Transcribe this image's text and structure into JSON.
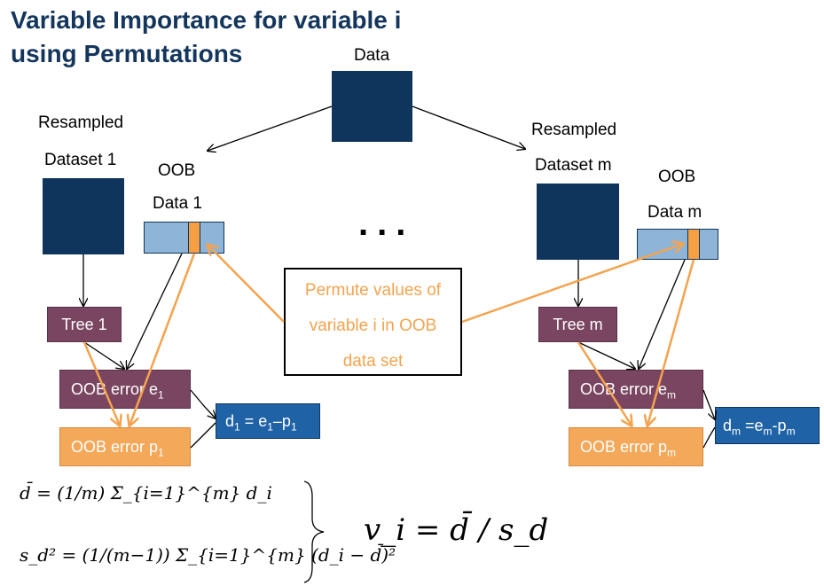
{
  "title": {
    "line1": "Variable Importance for variable i",
    "line2": "using Permutations"
  },
  "data_label": "Data",
  "left": {
    "resampled": "Resampled",
    "dataset": "Dataset 1",
    "oob": "OOB",
    "oob_data": "Data 1",
    "tree": "Tree 1",
    "err_e": "OOB error e",
    "err_e_sub": "1",
    "err_p": "OOB error p",
    "err_p_sub": "1",
    "d_main": "d",
    "d_sub": "1",
    "d_eq": " = e",
    "d_eq_sub": "1",
    "d_minus": "–p",
    "d_minus_sub": "1"
  },
  "right": {
    "resampled": "Resampled",
    "dataset": "Dataset m",
    "oob": "OOB",
    "oob_data": "Data m",
    "tree": "Tree m",
    "err_e": "OOB error e",
    "err_e_sub": "m",
    "err_p": "OOB error p",
    "err_p_sub": "m",
    "d_main": "d",
    "d_sub": "m",
    "d_eq": " =e",
    "d_eq_sub": "m",
    "d_minus": "-p",
    "d_minus_sub": "m"
  },
  "ellipsis": "...",
  "permute": {
    "line1": "Permute values of",
    "line2": "variable i in OOB",
    "line3": "data set"
  },
  "formulas": {
    "mean": "d̄ = (1/m) Σ_{i=1}^{m} d_i",
    "variance": "s_d² = (1/(m−1)) Σ_{i=1}^{m} (d_i − d̄)²",
    "importance": "v_i = d̄ / s_d"
  },
  "colors": {
    "navy": "#10355c",
    "tree": "#7a4560",
    "orange": "#f4a85a",
    "blue": "#1f63a6",
    "oob": "#8eb4d8",
    "title": "#14365d"
  }
}
